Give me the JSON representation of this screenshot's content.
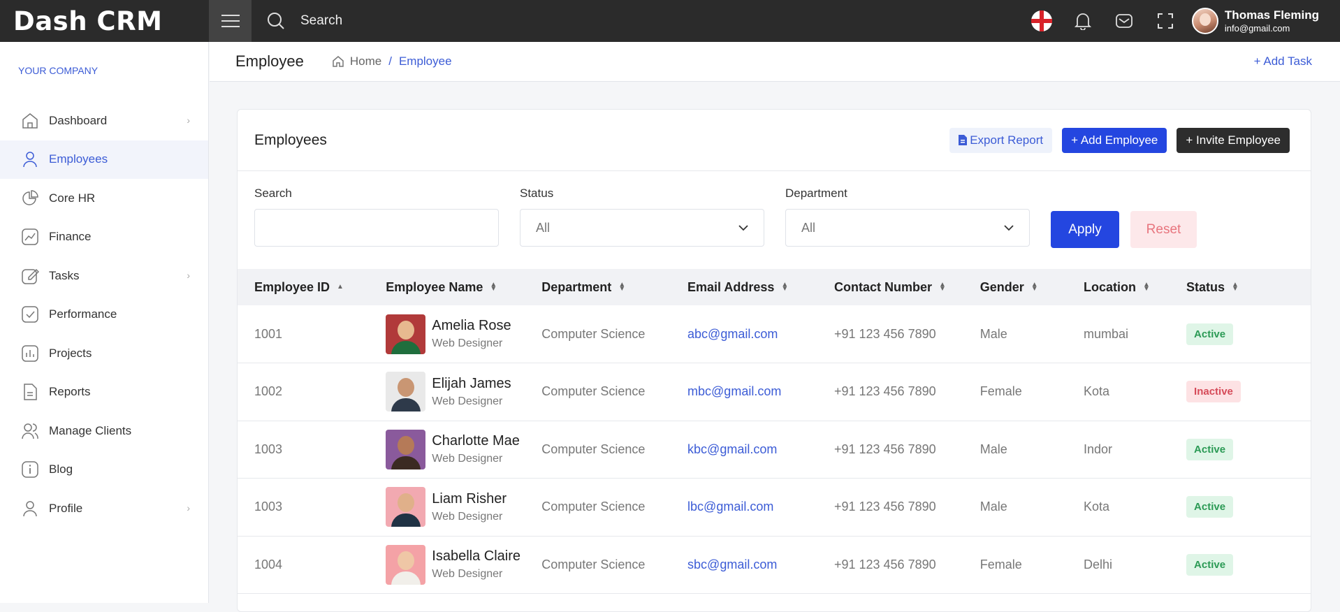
{
  "app": {
    "logo": "Dash CRM",
    "search_label": "Search"
  },
  "user": {
    "name": "Thomas Fleming",
    "email": "info@gmail.com"
  },
  "sidebar": {
    "company": "YOUR COMPANY",
    "items": [
      {
        "label": "Dashboard",
        "icon": "home-icon",
        "chevron": true
      },
      {
        "label": "Employees",
        "icon": "user-icon",
        "chevron": false,
        "active": true
      },
      {
        "label": "Core HR",
        "icon": "pie-chart-icon",
        "chevron": false
      },
      {
        "label": "Finance",
        "icon": "trend-chart-icon",
        "chevron": false
      },
      {
        "label": "Tasks",
        "icon": "edit-icon",
        "chevron": true
      },
      {
        "label": "Performance",
        "icon": "check-square-icon",
        "chevron": false
      },
      {
        "label": "Projects",
        "icon": "bar-chart-icon",
        "chevron": false
      },
      {
        "label": "Reports",
        "icon": "file-icon",
        "chevron": false
      },
      {
        "label": "Manage Clients",
        "icon": "users-icon",
        "chevron": false
      },
      {
        "label": "Blog",
        "icon": "info-icon",
        "chevron": false
      },
      {
        "label": "Profile",
        "icon": "user-icon",
        "chevron": true
      }
    ]
  },
  "subheader": {
    "title": "Employee",
    "crumb_home": "Home",
    "crumb_sep": "/",
    "crumb_current": "Employee",
    "add_task": "+ Add Task"
  },
  "card": {
    "title": "Employees",
    "export_label": "Export Report",
    "add_label": "+ Add Employee",
    "invite_label": "+ Invite Employee"
  },
  "filters": {
    "search_label": "Search",
    "search_value": "",
    "status_label": "Status",
    "status_value": "All",
    "department_label": "Department",
    "department_value": "All",
    "apply_label": "Apply",
    "reset_label": "Reset"
  },
  "table": {
    "headers": [
      "Employee ID",
      "Employee Name",
      "Department",
      "Email Address",
      "Contact Number",
      "Gender",
      "Location",
      "Status"
    ],
    "rows": [
      {
        "id": "1001",
        "name": "Amelia Rose",
        "role": "Web Designer",
        "department": "Computer Science",
        "email": "abc@gmail.com",
        "contact": "+91 123 456 7890",
        "gender": "Male",
        "location": "mumbai",
        "status": "Active"
      },
      {
        "id": "1002",
        "name": "Elijah James",
        "role": "Web Designer",
        "department": "Computer Science",
        "email": "mbc@gmail.com",
        "contact": "+91 123 456 7890",
        "gender": "Female",
        "location": "Kota",
        "status": "Inactive"
      },
      {
        "id": "1003",
        "name": "Charlotte Mae",
        "role": "Web Designer",
        "department": "Computer Science",
        "email": "kbc@gmail.com",
        "contact": "+91 123 456 7890",
        "gender": "Male",
        "location": "Indor",
        "status": "Active"
      },
      {
        "id": "1003",
        "name": "Liam Risher",
        "role": "Web Designer",
        "department": "Computer Science",
        "email": "lbc@gmail.com",
        "contact": "+91 123 456 7890",
        "gender": "Male",
        "location": "Kota",
        "status": "Active"
      },
      {
        "id": "1004",
        "name": "Isabella Claire",
        "role": "Web Designer",
        "department": "Computer Science",
        "email": "sbc@gmail.com",
        "contact": "+91 123 456 7890",
        "gender": "Female",
        "location": "Delhi",
        "status": "Active"
      }
    ]
  },
  "colors": {
    "accent": "#2446e0",
    "link": "#3c5cd6",
    "topbar": "#2b2b2b",
    "active_badge": "#2b9a55",
    "inactive_badge": "#d64b59"
  }
}
